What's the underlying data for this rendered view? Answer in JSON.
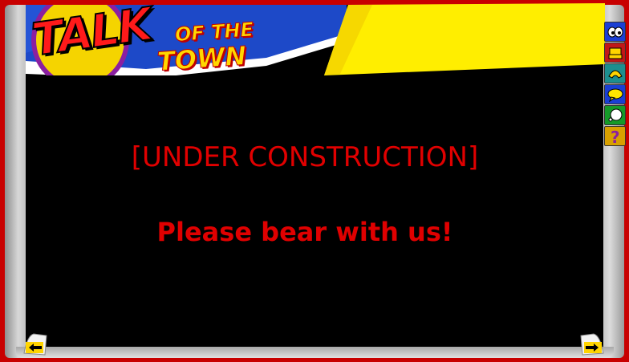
{
  "logo": {
    "talk": "TALK",
    "of_the": "OF THE",
    "town": "TOWN"
  },
  "main": {
    "heading": "[UNDER CONSTRUCTION]",
    "message": "Please bear with us!"
  },
  "colors": {
    "text_red": "#e00000",
    "banner_blue": "#1d49c8",
    "flag_yellow": "#ffee00",
    "frame_red": "#c80000"
  },
  "tabs": [
    {
      "icon": "eyes-icon",
      "color": "#1a3fd4"
    },
    {
      "icon": "chest-icon",
      "color": "#c01818"
    },
    {
      "icon": "phone-icon",
      "color": "#1d8f8f"
    },
    {
      "icon": "speech-bubble-icon",
      "color": "#1a3fd4"
    },
    {
      "icon": "thinking-icon",
      "color": "#159a28"
    },
    {
      "icon": "question-icon",
      "color": "#d8a000"
    }
  ],
  "navigation": {
    "prev_icon": "arrow-left-icon",
    "next_icon": "arrow-right-icon"
  }
}
